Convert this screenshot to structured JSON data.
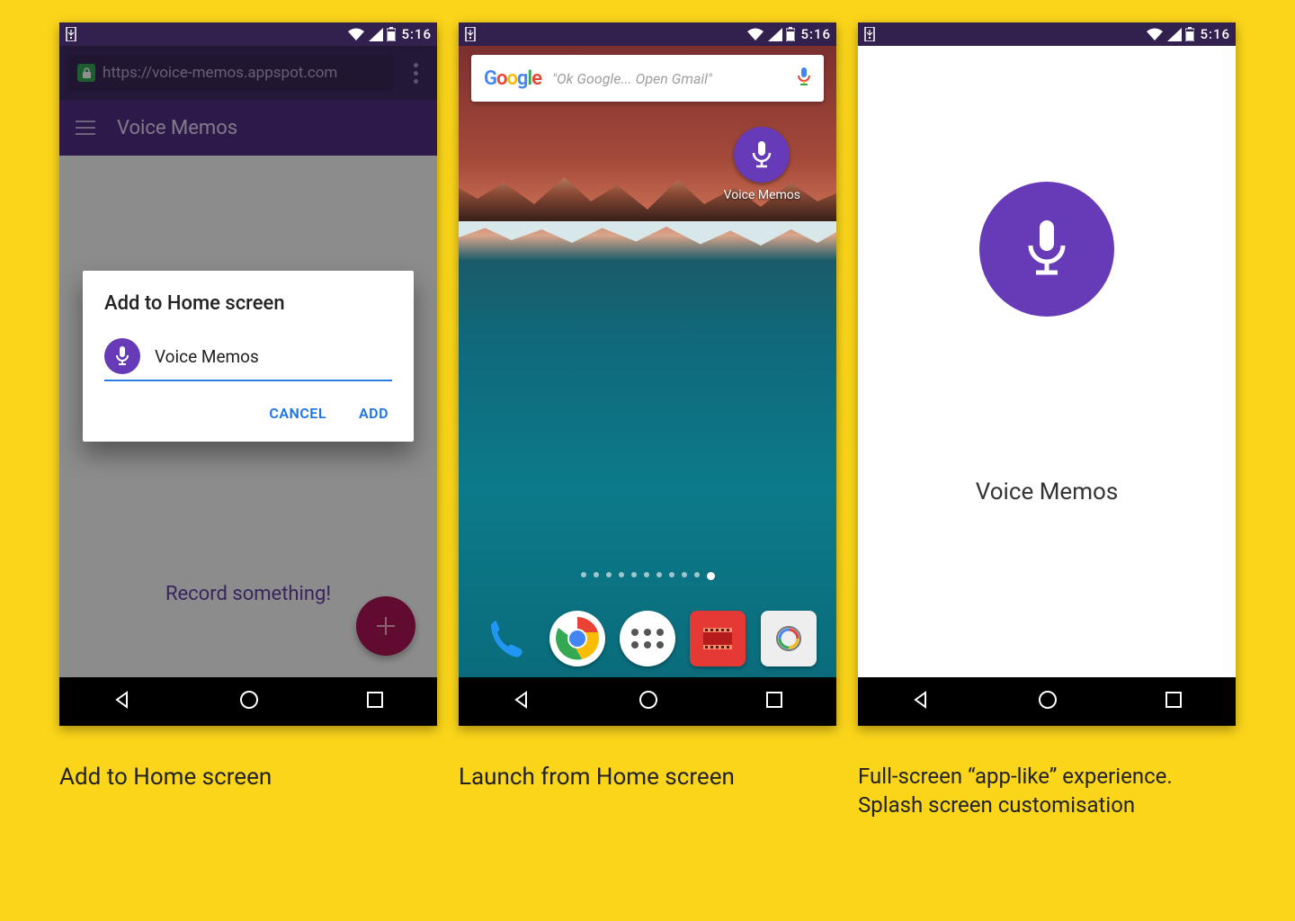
{
  "status": {
    "time": "5:16"
  },
  "phone1": {
    "url": "https://voice-memos.appspot.com",
    "app_title": "Voice Memos",
    "body_text": "Record something!",
    "dialog_title": "Add to Home screen",
    "dialog_value": "Voice Memos",
    "cancel": "CANCEL",
    "add": "ADD"
  },
  "phone2": {
    "search_hint": "\"Ok Google... Open Gmail\"",
    "app_label": "Voice Memos",
    "page_count": 11,
    "page_active": 11
  },
  "phone3": {
    "splash_title": "Voice Memos"
  },
  "captions": {
    "c1": "Add to Home screen",
    "c2": "Launch from Home screen",
    "c3": "Full-screen “app-like” experience. Splash screen customisation"
  }
}
